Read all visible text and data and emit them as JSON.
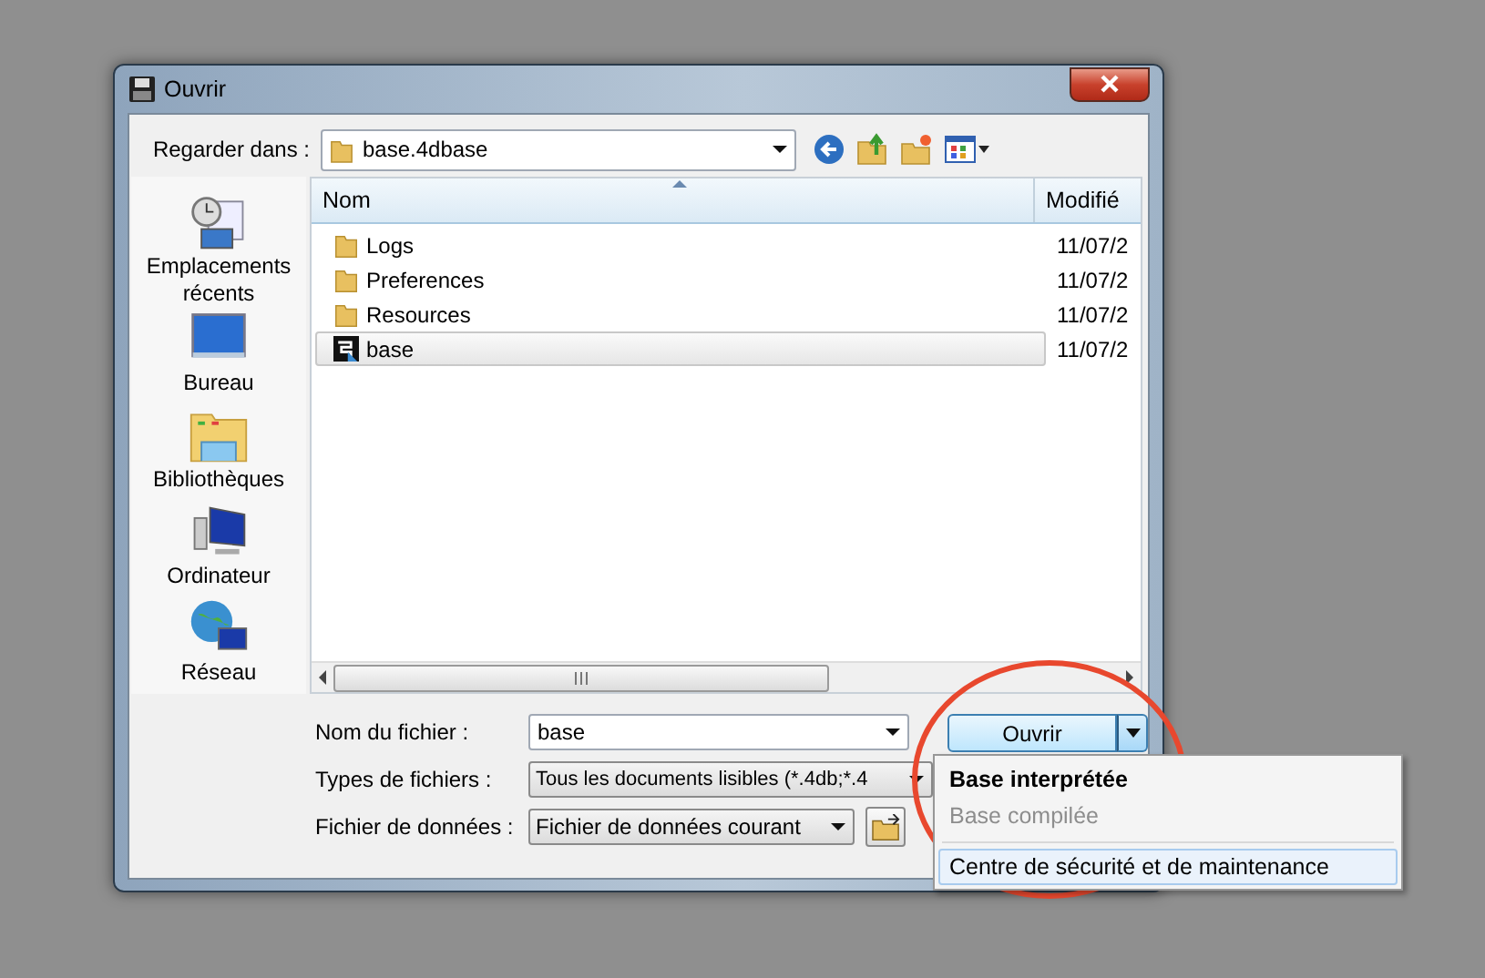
{
  "window": {
    "title": "Ouvrir"
  },
  "look_in": {
    "label": "Regarder dans :",
    "value": "base.4dbase"
  },
  "places": [
    {
      "label": "Emplacements récents",
      "kind": "recent"
    },
    {
      "label": "Bureau",
      "kind": "desktop"
    },
    {
      "label": "Bibliothèques",
      "kind": "libraries"
    },
    {
      "label": "Ordinateur",
      "kind": "computer"
    },
    {
      "label": "Réseau",
      "kind": "network"
    }
  ],
  "file_list": {
    "columns": [
      "Nom",
      "Modifié"
    ],
    "rows": [
      {
        "name": "Logs",
        "modified": "11/07/2",
        "kind": "folder",
        "selected": false
      },
      {
        "name": "Preferences",
        "modified": "11/07/2",
        "kind": "folder",
        "selected": false
      },
      {
        "name": "Resources",
        "modified": "11/07/2",
        "kind": "folder",
        "selected": false
      },
      {
        "name": "base",
        "modified": "11/07/2",
        "kind": "database",
        "selected": true
      }
    ]
  },
  "form": {
    "file_name": {
      "label": "Nom du fichier :",
      "value": "base"
    },
    "file_type": {
      "label": "Types de fichiers :",
      "value": "Tous les documents lisibles (*.4db;*.4"
    },
    "data_file": {
      "label": "Fichier de données :",
      "value": "Fichier de données courant"
    }
  },
  "open_button": {
    "label": "Ouvrir"
  },
  "open_menu": [
    {
      "label": "Base interprétée",
      "kind": "default",
      "selected": false
    },
    {
      "label": "Base compilée",
      "kind": "disabled",
      "selected": false
    },
    {
      "label": "Centre de sécurité et de maintenance",
      "kind": "normal",
      "selected": true
    }
  ]
}
